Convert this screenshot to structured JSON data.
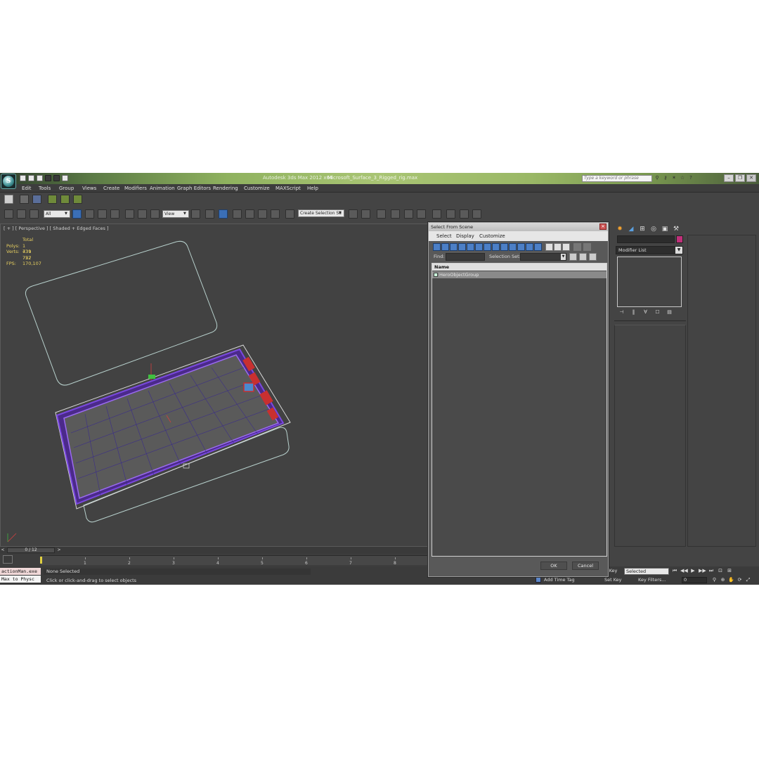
{
  "window": {
    "app_title": "Autodesk 3ds Max  2012 x64",
    "file_title": "Microsoft_Surface_3_Rigged_rig.max",
    "search_placeholder": "Type a keyword or phrase"
  },
  "menu": [
    "Edit",
    "Tools",
    "Group",
    "Views",
    "Create",
    "Modifiers",
    "Animation",
    "Graph Editors",
    "Rendering",
    "Customize",
    "MAXScript",
    "Help"
  ],
  "toolbar": {
    "selection_filter": "All",
    "reference_coord": "View",
    "named_selection": "Create Selection Se"
  },
  "viewport": {
    "label": "[ + ] [ Perspective ] [ Shaded + Edged Faces ]",
    "stats": {
      "header": "Total",
      "polys_label": "Polys:",
      "polys_value": "1 439 722",
      "verts_label": "Verts:",
      "verts_value": "731 757",
      "fps_label": "FPS:",
      "fps_value": "170,107"
    }
  },
  "command_panel": {
    "modifier_list": "Modifier List",
    "object_color": "#c0307a"
  },
  "dialog": {
    "title": "Select From Scene",
    "menu": [
      "Select",
      "Display",
      "Customize"
    ],
    "find_label": "Find:",
    "selection_set_label": "Selection Set:",
    "column_name": "Name",
    "rows": [
      "HeroObjectGroup"
    ],
    "ok": "OK",
    "cancel": "Cancel"
  },
  "timeline": {
    "slider": "0 / 12",
    "ticks": [
      "1",
      "2",
      "3",
      "4",
      "5",
      "6",
      "7",
      "8"
    ]
  },
  "status": {
    "maxscript_line1": "actionMan.exe",
    "maxscript_line2": "Max to Physc",
    "selection": "None Selected",
    "prompt": "Click or click-and-drag to select objects",
    "add_time_tag": "Add Time Tag",
    "auto_key": "to Key",
    "set_key": "Set Key",
    "key_mode": "Selected",
    "key_filters": "Key Filters...",
    "frame": "0"
  }
}
